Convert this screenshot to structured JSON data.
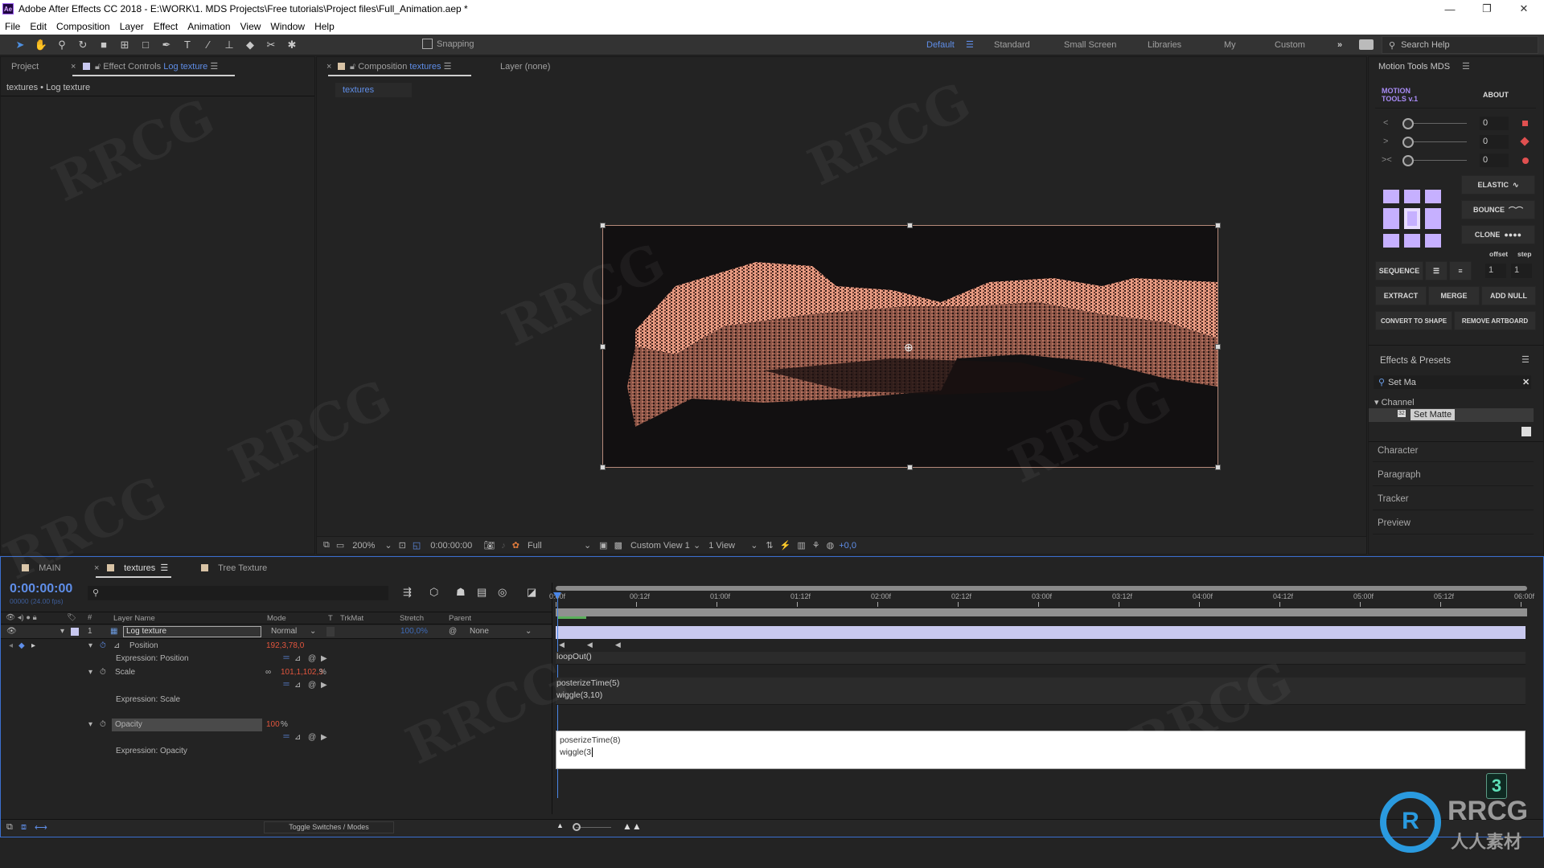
{
  "window": {
    "app_icon": "Ae",
    "title": "Adobe After Effects CC 2018 - E:\\WORK\\1. MDS Projects\\Free tutorials\\Project files\\Full_Animation.aep *",
    "controls": {
      "minimize": "—",
      "restore": "❐",
      "close": "✕"
    }
  },
  "menu": [
    "File",
    "Edit",
    "Composition",
    "Layer",
    "Effect",
    "Animation",
    "View",
    "Window",
    "Help"
  ],
  "toolbar": {
    "tools": [
      "selection-tool",
      "hand-tool",
      "zoom-tool",
      "rotation-tool",
      "camera-tool",
      "pan-behind-tool",
      "rectangle-tool",
      "pen-tool",
      "type-tool",
      "brush-tool",
      "clone-stamp-tool",
      "eraser-tool",
      "roto-brush-tool",
      "puppet-pin-tool"
    ],
    "snapping_label": "Snapping",
    "snapping_checked": false,
    "workspaces": [
      {
        "label": "Default",
        "active": true
      },
      {
        "label": "Standard",
        "active": false
      },
      {
        "label": "Small Screen",
        "active": false
      },
      {
        "label": "Libraries",
        "active": false
      },
      {
        "label": "My",
        "active": false
      },
      {
        "label": "Custom",
        "active": false
      }
    ],
    "overflow": "»",
    "search_help_placeholder": "Search Help"
  },
  "left_panel": {
    "tab_project": "Project",
    "tab_effect_controls": "Effect Controls",
    "effect_controls_layer": "Log texture",
    "breadcrumb": "textures • Log texture"
  },
  "viewer": {
    "tab_composition": "Composition",
    "comp_name": "textures",
    "tab_layer": "Layer (none)",
    "subtab": "textures",
    "zoom": "200%",
    "timecode": "0:00:00:00",
    "resolution": "Full",
    "view": "Custom View 1",
    "views_count": "1 View",
    "exposure": "+0,0"
  },
  "right_panel": {
    "motion_tools": {
      "title": "Motion Tools MDS",
      "logo": "MOTION TOOLS v.1",
      "about": "ABOUT",
      "sliders": [
        {
          "icon": "<",
          "value": "0"
        },
        {
          "icon": ">",
          "value": "0"
        },
        {
          "icon": "><",
          "value": "0"
        }
      ],
      "buttons": {
        "elastic": "ELASTIC",
        "bounce": "BOUNCE",
        "clone": "CLONE",
        "offset_label": "offset",
        "step_label": "step",
        "sequence": "SEQUENCE",
        "offset_value": "1",
        "step_value": "1",
        "extract": "EXTRACT",
        "merge": "MERGE",
        "add_null": "ADD NULL",
        "convert_to_shape": "CONVERT TO SHAPE",
        "remove_artboard": "REMOVE ARTBOARD"
      }
    },
    "effects_presets": {
      "title": "Effects & Presets",
      "search_value": "Set Ma",
      "category": "Channel",
      "result": "Set Matte",
      "result_badge": "32"
    },
    "collapsed_panels": [
      "Character",
      "Paragraph",
      "Tracker",
      "Preview"
    ]
  },
  "timeline": {
    "tabs": [
      {
        "label": "MAIN",
        "color": "#d8c3a5",
        "active": false
      },
      {
        "label": "textures",
        "color": "#d8c3a5",
        "active": true
      },
      {
        "label": "Tree Texture",
        "color": "#d8c3a5",
        "active": false
      }
    ],
    "timecode": "0:00:00:00",
    "frame_info": "00000 (24.00 fps)",
    "search_placeholder": "",
    "columns": {
      "layer_name": "Layer Name",
      "mode": "Mode",
      "t": "T",
      "trkmat": "TrkMat",
      "stretch": "Stretch",
      "parent": "Parent"
    },
    "layer": {
      "number": "1",
      "name": "Log texture",
      "mode": "Normal",
      "stretch": "100,0%",
      "parent": "None",
      "label_color": "#c8c8f0"
    },
    "properties": [
      {
        "name": "Position",
        "value": "192,3,78,0",
        "expr_label": "Expression: Position",
        "expression": [
          "loopOut()"
        ]
      },
      {
        "name": "Scale",
        "value": "101,1,102,3",
        "unit": "%",
        "expr_label": "Expression: Scale",
        "expression": [
          "posterizeTime(5)",
          "wiggle(3,10)"
        ]
      },
      {
        "name": "Opacity",
        "value": "100",
        "unit": "%",
        "expr_label": "Expression: Opacity",
        "expression": [
          "poserizeTime(8)",
          "wiggle(3"
        ]
      }
    ],
    "ruler": [
      "0:00f",
      "00:12f",
      "01:00f",
      "01:12f",
      "02:00f",
      "02:12f",
      "03:00f",
      "03:12f",
      "04:00f",
      "04:12f",
      "05:00f",
      "05:12f",
      "06:00f"
    ],
    "toggle_label": "Toggle Switches / Modes",
    "playhead_fraction": 0.0
  },
  "overlay": {
    "key_badge": "3",
    "watermark_brand": "RRCG",
    "watermark_sub": "人人素材"
  },
  "colors": {
    "accent_blue": "#5f8ee8",
    "value_red": "#e2553d",
    "motion_purple": "#a88bf5",
    "clip_lavender": "#c9c9ef"
  }
}
